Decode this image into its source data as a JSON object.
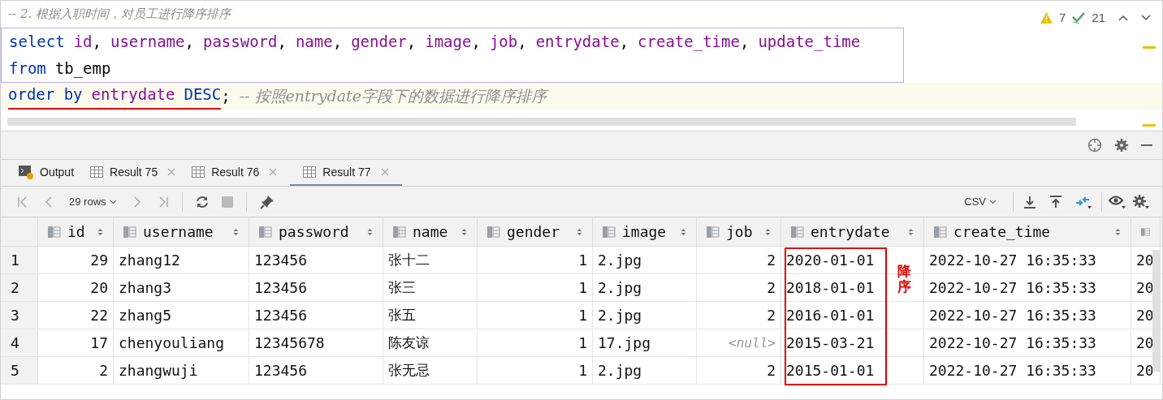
{
  "editor": {
    "lines": [
      {
        "kind": "comment",
        "tokens": [
          {
            "kind": "comment",
            "text": "-- 2. 根据入职时间，对员工进行降序排序"
          }
        ]
      },
      {
        "kind": "selected",
        "tokens": [
          {
            "kind": "keyword",
            "text": "select"
          },
          {
            "kind": "ident",
            "text": "id"
          },
          {
            "kind": "punct",
            "text": ","
          },
          {
            "kind": "ident",
            "text": "username"
          },
          {
            "kind": "punct",
            "text": ","
          },
          {
            "kind": "ident",
            "text": "password"
          },
          {
            "kind": "punct",
            "text": ","
          },
          {
            "kind": "ident",
            "text": "name"
          },
          {
            "kind": "punct",
            "text": ","
          },
          {
            "kind": "ident",
            "text": "gender"
          },
          {
            "kind": "punct",
            "text": ","
          },
          {
            "kind": "ident",
            "text": "image"
          },
          {
            "kind": "punct",
            "text": ","
          },
          {
            "kind": "ident",
            "text": "job"
          },
          {
            "kind": "punct",
            "text": ","
          },
          {
            "kind": "ident",
            "text": "entrydate"
          },
          {
            "kind": "punct",
            "text": ","
          },
          {
            "kind": "ident",
            "text": "create_time"
          },
          {
            "kind": "punct",
            "text": ","
          },
          {
            "kind": "ident",
            "text": "update_time"
          }
        ]
      },
      {
        "kind": "selected",
        "tokens": [
          {
            "kind": "keyword",
            "text": "from"
          },
          {
            "kind": "plain",
            "text": "tb_emp"
          }
        ]
      },
      {
        "kind": "current",
        "tokens": [
          {
            "kind": "keyword",
            "text": "order by",
            "underlined": true
          },
          {
            "kind": "ident",
            "text": "entrydate",
            "underlined": true
          },
          {
            "kind": "keyword",
            "text": "DESC",
            "underlined": true
          },
          {
            "kind": "punct",
            "text": ";"
          },
          {
            "kind": "comment",
            "text": "-- 按照entrydate字段下的数据进行降序排序"
          }
        ]
      }
    ],
    "warnings": "7",
    "checks": "21"
  },
  "tabs": [
    {
      "label": "Output",
      "kind": "output",
      "selected": false,
      "closable": false
    },
    {
      "label": "Result 75",
      "kind": "result",
      "selected": false,
      "closable": true
    },
    {
      "label": "Result 76",
      "kind": "result",
      "selected": false,
      "closable": true
    },
    {
      "label": "Result 77",
      "kind": "result",
      "selected": true,
      "closable": true
    }
  ],
  "toolbar": {
    "rows": "29 rows",
    "format": "CSV"
  },
  "table": {
    "columns": [
      {
        "label": "id"
      },
      {
        "label": "username"
      },
      {
        "label": "password"
      },
      {
        "label": "name"
      },
      {
        "label": "gender"
      },
      {
        "label": "image"
      },
      {
        "label": "job"
      },
      {
        "label": "entrydate"
      },
      {
        "label": "create_time"
      },
      {}
    ],
    "rows": [
      {
        "number": "1",
        "cells": [
          "29",
          "zhang12",
          "123456",
          "张十二",
          "1",
          "2.jpg",
          "2",
          "2020-01-01",
          "2022-10-27 16:35:33",
          "20"
        ]
      },
      {
        "number": "2",
        "cells": [
          "20",
          "zhang3",
          "123456",
          "张三",
          "1",
          "2.jpg",
          "2",
          "2018-01-01",
          "2022-10-27 16:35:33",
          "20"
        ]
      },
      {
        "number": "3",
        "cells": [
          "22",
          "zhang5",
          "123456",
          "张五",
          "1",
          "2.jpg",
          "2",
          "2016-01-01",
          "2022-10-27 16:35:33",
          "20"
        ]
      },
      {
        "number": "4",
        "cells": [
          "17",
          "chenyouliang",
          "12345678",
          "陈友谅",
          "1",
          "17.jpg",
          "<null>",
          "2015-03-21",
          "2022-10-27 16:35:33",
          "20"
        ]
      },
      {
        "number": "5",
        "cells": [
          "2",
          "zhangwuji",
          "123456",
          "张无忌",
          "1",
          "2.jpg",
          "2",
          "2015-01-01",
          "2022-10-27 16:35:33",
          "20"
        ]
      }
    ]
  },
  "annotation": {
    "text": "降序"
  }
}
